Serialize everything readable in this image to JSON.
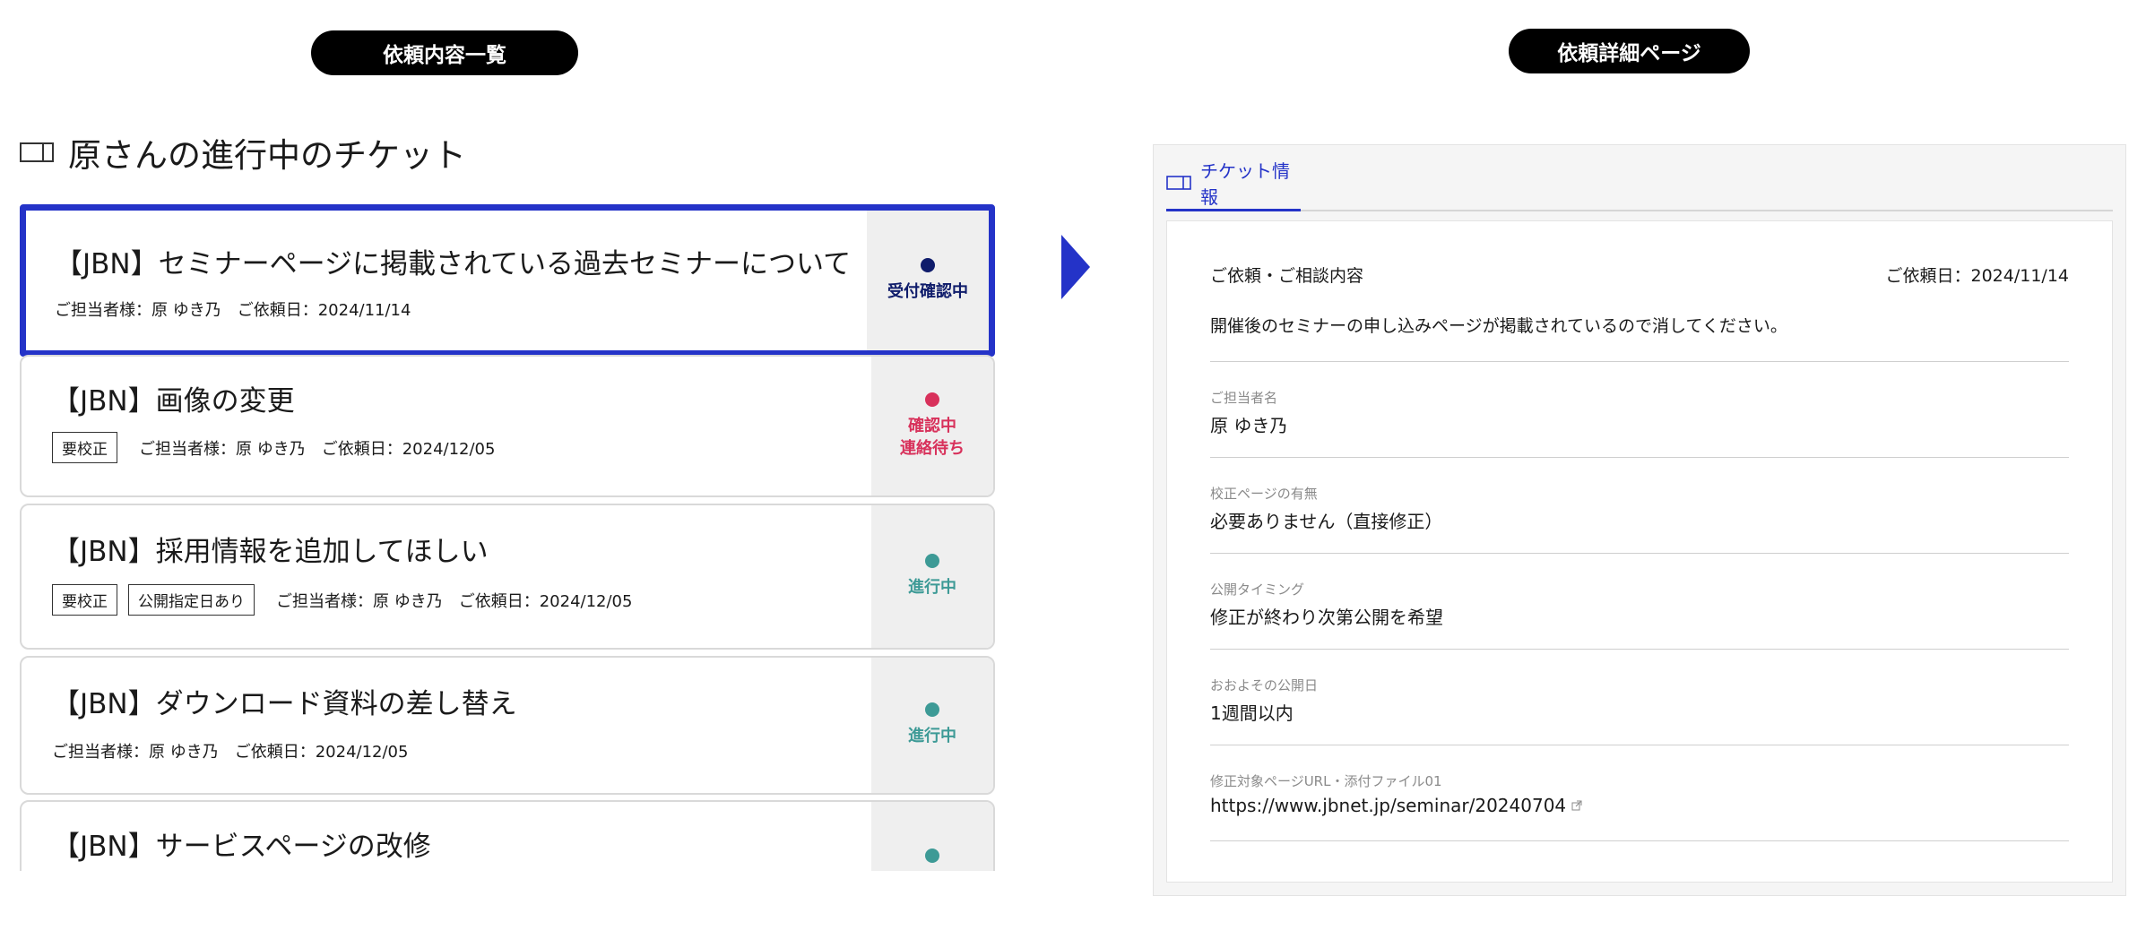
{
  "left_panel_label": "依頼内容一覧",
  "right_panel_label": "依頼詳細ページ",
  "page_title": "原さんの進行中のチケット",
  "tickets": [
    {
      "title": "【JBN】セミナーページに掲載されている過去セミナーについて",
      "meta": "ご担当者様：原 ゆき乃　ご依頼日：2024/11/14",
      "tags": [],
      "status": "受付確認中",
      "status_color": "#0f1c6b"
    },
    {
      "title": "【JBN】画像の変更",
      "meta": "ご担当者様：原 ゆき乃　ご依頼日：2024/12/05",
      "tags": [
        "要校正"
      ],
      "status": "確認中\n連絡待ち",
      "status_color": "#d8315b"
    },
    {
      "title": "【JBN】採用情報を追加してほしい",
      "meta": "ご担当者様：原 ゆき乃　ご依頼日：2024/12/05",
      "tags": [
        "要校正",
        "公開指定日あり"
      ],
      "status": "進行中",
      "status_color": "#3d9a96"
    },
    {
      "title": "【JBN】ダウンロード資料の差し替え",
      "meta": "ご担当者様：原 ゆき乃　ご依頼日：2024/12/05",
      "tags": [],
      "status": "進行中",
      "status_color": "#3d9a96"
    },
    {
      "title": "【JBN】サービスページの改修",
      "meta": "",
      "tags": [],
      "status": "",
      "status_color": "#3d9a96"
    }
  ],
  "detail": {
    "tab_label": "チケット情報",
    "heading": "ご依頼・ご相談内容",
    "request_date": "ご依頼日：2024/11/14",
    "description": "開催後のセミナーの申し込みページが掲載されているので消してください。",
    "fields": [
      {
        "label": "ご担当者名",
        "value": "原 ゆき乃"
      },
      {
        "label": "校正ページの有無",
        "value": "必要ありません（直接修正）"
      },
      {
        "label": "公開タイミング",
        "value": "修正が終わり次第公開を希望"
      },
      {
        "label": "おおよその公開日",
        "value": "1週間以内"
      },
      {
        "label": "修正対象ページURL・添付ファイル01",
        "value": "https://www.jbnet.jp/seminar/20240704"
      }
    ]
  },
  "icons": {
    "ticket": "ticket-icon",
    "arrow": "arrow-right-icon",
    "external": "external-link-icon"
  },
  "colors": {
    "accent": "#2433c8"
  }
}
